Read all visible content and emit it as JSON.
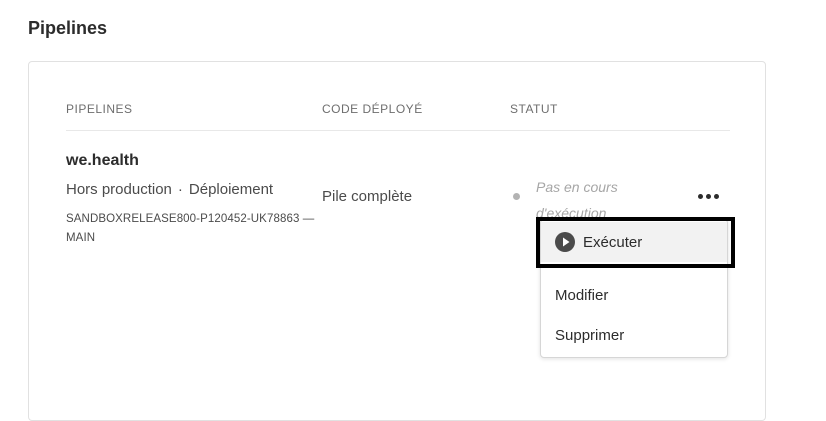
{
  "page": {
    "title": "Pipelines"
  },
  "table": {
    "headers": {
      "pipelines": "PIPELINES",
      "code": "CODE DÉPLOYÉ",
      "status": "STATUT"
    },
    "row": {
      "name": "we.health",
      "environment": "Hors production",
      "separator": "·",
      "type": "Déploiement",
      "repo": "SANDBOXRELEASE800-P120452-UK78863 — MAIN",
      "code": "Pile complète",
      "status": "Pas en cours d'exécution",
      "status_color": "#b3b3b3"
    }
  },
  "menu": {
    "items": [
      {
        "label": "Exécuter",
        "icon": "play-circle-icon",
        "highlighted": true
      },
      {
        "label": "Modifier"
      },
      {
        "label": "Supprimer"
      }
    ]
  },
  "colors": {
    "text": "#2c2c2c",
    "muted": "#6e6e6e",
    "status_italic": "#a6a6a6",
    "highlight_border": "#000000"
  }
}
